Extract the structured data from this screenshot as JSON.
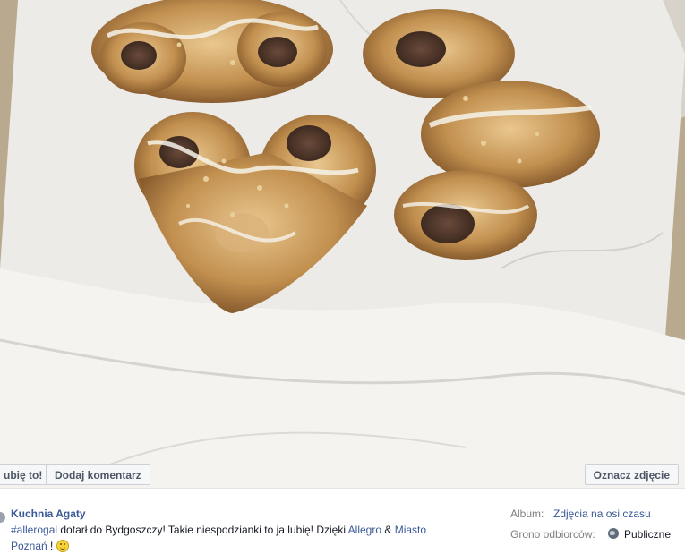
{
  "photo": {
    "alt": "Pastries in a box on parchment paper"
  },
  "actions": {
    "like_label": "ubię to!",
    "comment_label": "Dodaj komentarz",
    "tag_label": "Oznacz zdjęcie"
  },
  "post": {
    "author": "Kuchnia Agaty",
    "hashtag": "#allerogal",
    "text_1": " dotarł do Bydgoszczy! Takie niespodzianki to ja lubię! Dzięki ",
    "link_allegro": "Allegro",
    "amp": " & ",
    "link_city_1": "Miasto",
    "link_city_2": "Poznań",
    "text_end": " ! "
  },
  "meta": {
    "album_label": "Album:",
    "album_value": "Zdjęcia na osi czasu",
    "audience_label": "Grono odbiorców:",
    "audience_value": "Publiczne"
  },
  "colors": {
    "link": "#3b5998",
    "button_bg": "#f6f7f9",
    "paper": "#e7e5e1",
    "pastry": "#c99a62"
  },
  "icons": [
    "smiley-icon",
    "globe-icon"
  ]
}
